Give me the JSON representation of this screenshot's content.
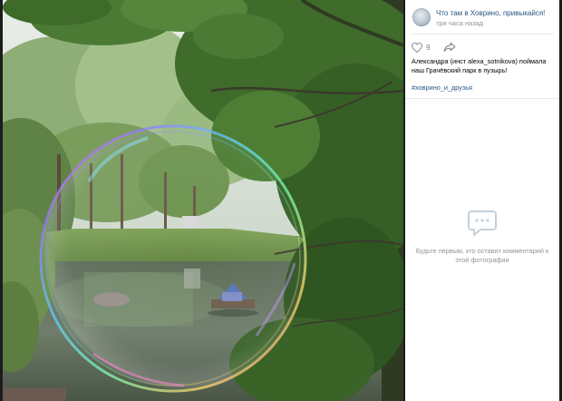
{
  "post": {
    "group_name": "Что там в Ховрино, привыкайся!",
    "time": "три часа назад",
    "likes": "9",
    "caption": "Александра (инст alexa_sotnikova) поймала наш Грачёвский парк в пузырь!",
    "hashtag": "#ховрино_и_друзья"
  },
  "comments": {
    "empty_text": "Будьте первым, кто оставит комментарий к этой фотографии"
  },
  "icons": {
    "like": "heart-icon",
    "share": "share-arrow-icon",
    "comments": "comment-bubble-icon"
  },
  "colors": {
    "link": "#2a5885",
    "muted": "#939393",
    "panel_bg": "#ffffff",
    "viewer_bg": "#1c1c1c"
  }
}
